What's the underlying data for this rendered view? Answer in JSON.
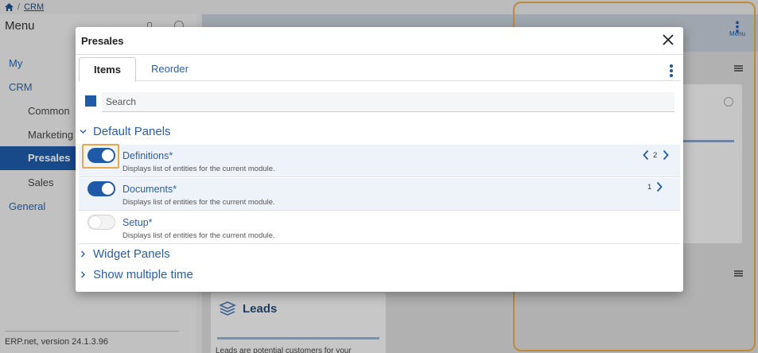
{
  "breadcrumb": {
    "home_icon": "home-icon",
    "current": "CRM"
  },
  "sidebar": {
    "title": "Menu",
    "items": [
      {
        "label": "My",
        "level": 0
      },
      {
        "label": "CRM",
        "level": 0
      },
      {
        "label": "Common",
        "level": 1
      },
      {
        "label": "Marketing",
        "level": 1
      },
      {
        "label": "Presales",
        "level": 1,
        "active": true
      },
      {
        "label": "Sales",
        "level": 1
      },
      {
        "label": "General",
        "level": 0
      }
    ],
    "version": "ERP.net, version 24.1.3.96"
  },
  "header": {
    "menu_label": "Menu"
  },
  "leads_card": {
    "title": "Leads",
    "text": "Leads are potential customers for your"
  },
  "dialog": {
    "title": "Presales",
    "tabs": [
      {
        "label": "Items",
        "active": true
      },
      {
        "label": "Reorder",
        "active": false
      }
    ],
    "search": {
      "placeholder": "Search",
      "value": ""
    },
    "groups": [
      {
        "label": "Default Panels",
        "expanded": true,
        "items": [
          {
            "title": "Definitions*",
            "description": "Displays list of entities for the current module.",
            "enabled": true,
            "count": "2",
            "focused": true
          },
          {
            "title": "Documents*",
            "description": "Displays list of entities for the current module.",
            "enabled": true,
            "count": "1"
          },
          {
            "title": "Setup*",
            "description": "Displays list of entities for the current module.",
            "enabled": false
          }
        ]
      },
      {
        "label": "Widget Panels",
        "expanded": false
      },
      {
        "label": "Show multiple time",
        "expanded": false
      }
    ]
  },
  "colors": {
    "accent": "#1e5aa8",
    "focus": "#e8a94a",
    "row_highlight": "#eef3f9"
  }
}
